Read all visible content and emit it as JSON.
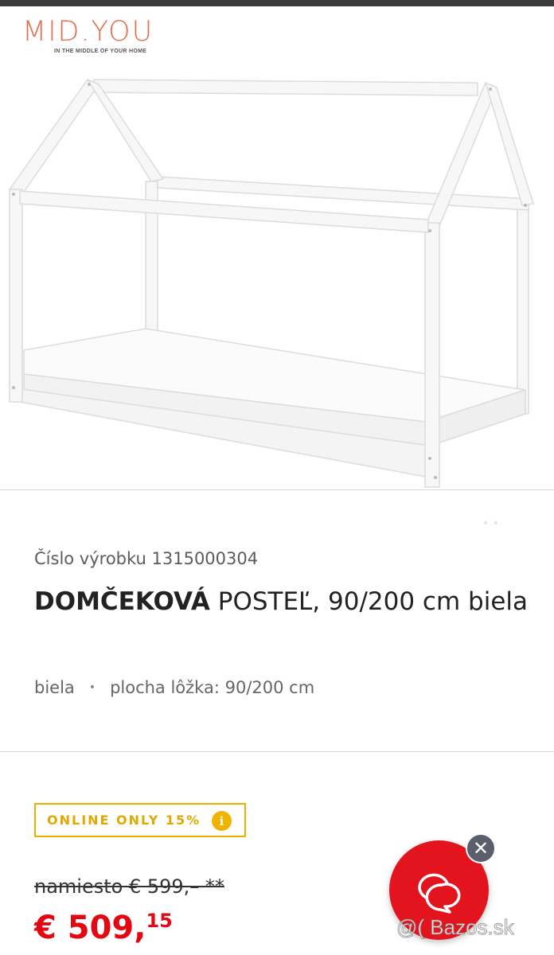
{
  "brand": {
    "logo_text": "MID.YOU",
    "tagline": "IN THE MIDDLE OF YOUR HOME",
    "color": "#e2704f"
  },
  "product": {
    "number": "Číslo výrobku 1315000304",
    "title_brand": "DOMČEKOVÁ",
    "title_rest": " POSTEĽ, 90/200 cm biela",
    "attributes": [
      "biela",
      "plocha lôžka: 90/200 cm"
    ],
    "gallery_dots": "• •"
  },
  "promo": {
    "badge": "ONLINE ONLY 15%",
    "info_icon": "i",
    "color": "#e8b100"
  },
  "pricing": {
    "old_price": "namiesto € 599,– **",
    "new_price_whole": "€ 509,",
    "new_price_cents": "15",
    "color": "#e30613"
  },
  "chat": {
    "close_label": "✕",
    "icon": "chat-bubbles-icon",
    "color": "#e3141d"
  },
  "watermark": "@( Bazos.sk"
}
